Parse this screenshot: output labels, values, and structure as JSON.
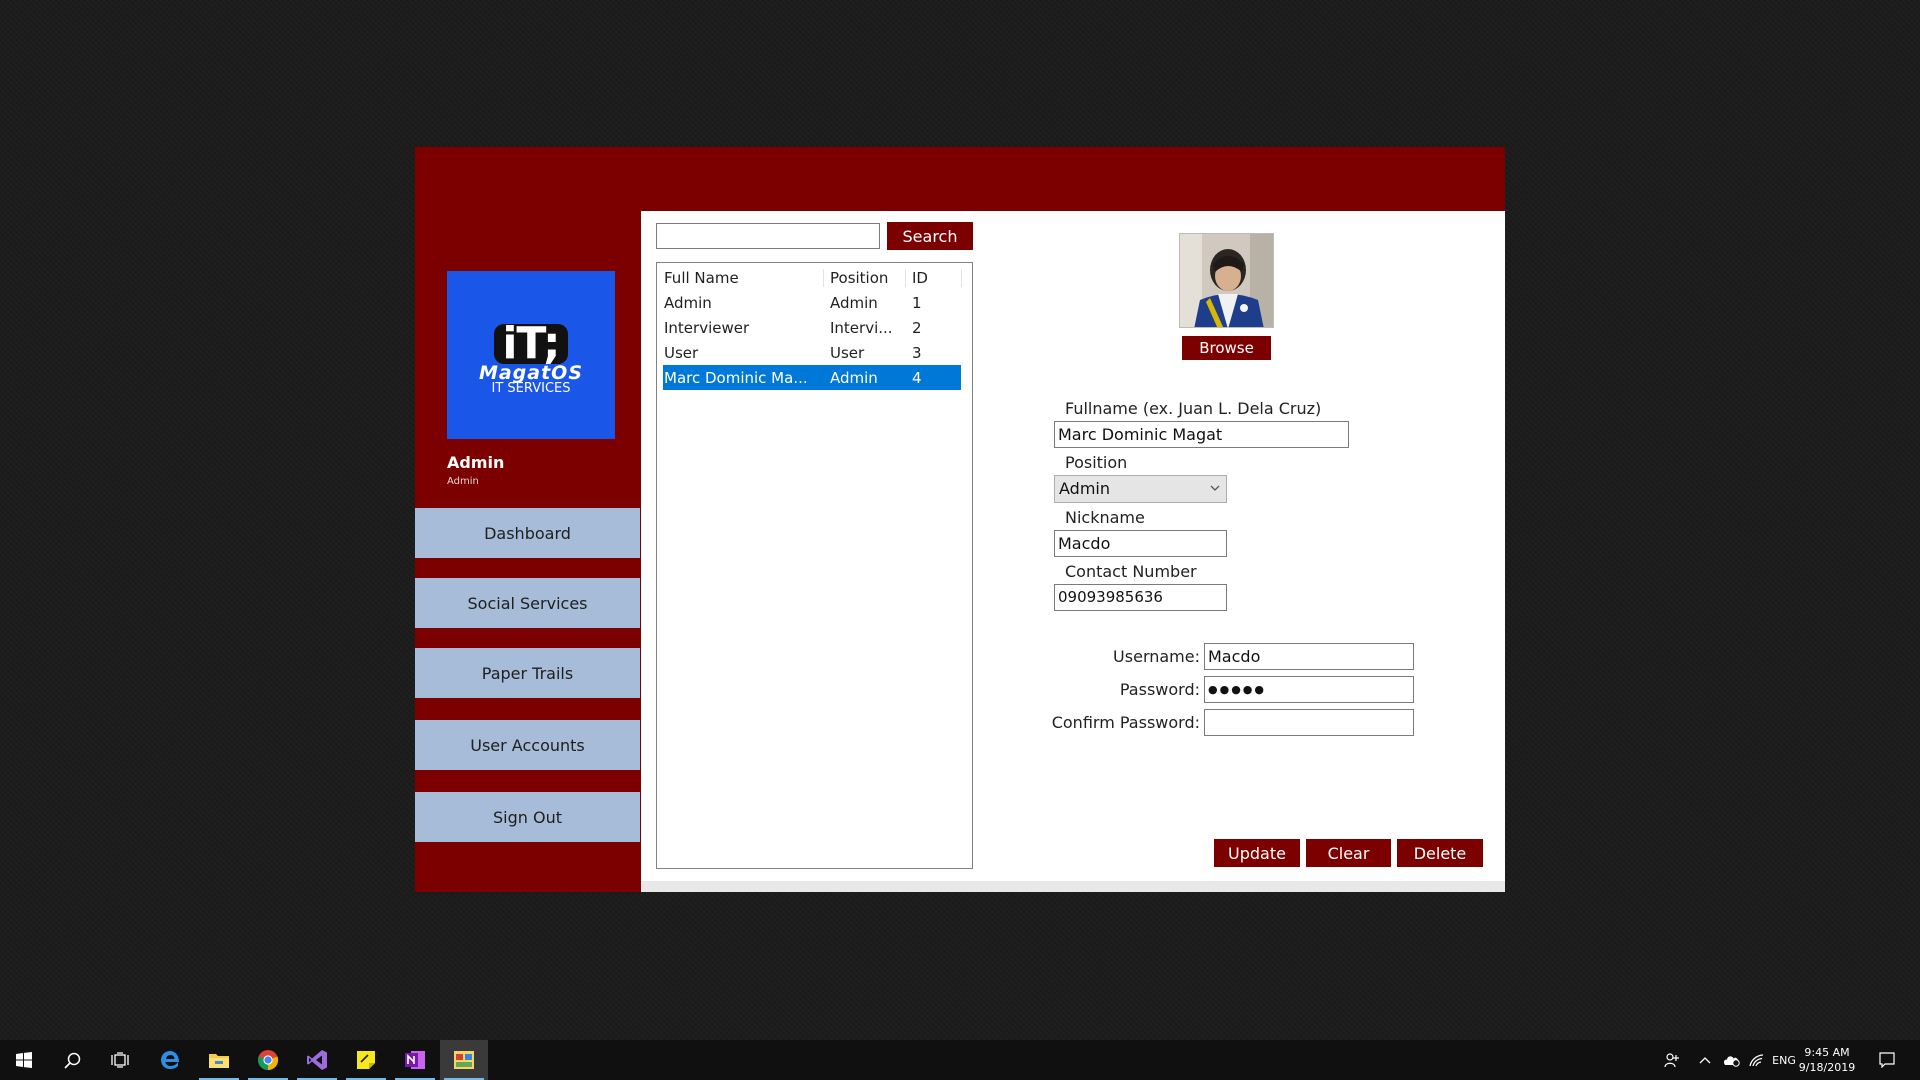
{
  "sidebar": {
    "logo": {
      "mark": "iT;",
      "name": "MagatOS",
      "sub": "IT SERVICES"
    },
    "user_name": "Admin",
    "user_role": "Admin",
    "nav": [
      {
        "label": "Dashboard"
      },
      {
        "label": "Social Services"
      },
      {
        "label": "Paper Trails"
      },
      {
        "label": "User Accounts"
      },
      {
        "label": "Sign Out"
      }
    ]
  },
  "search": {
    "value": "",
    "button_label": "Search"
  },
  "accounts_list": {
    "headers": [
      "Full Name",
      "Position",
      "ID"
    ],
    "rows": [
      {
        "name": "Admin",
        "position": "Admin",
        "id": "1"
      },
      {
        "name": "Interviewer",
        "position": "Intervi...",
        "id": "2"
      },
      {
        "name": "User",
        "position": "User",
        "id": "3"
      },
      {
        "name": "Marc Dominic Ma...",
        "position": "Admin",
        "id": "4"
      }
    ],
    "selected_index": 3
  },
  "profile": {
    "browse_label": "Browse",
    "fullname_label": "Fullname (ex. Juan L. Dela Cruz)",
    "fullname_value": "Marc Dominic Magat",
    "position_label": "Position",
    "position_value": "Admin",
    "nickname_label": "Nickname",
    "nickname_value": "Macdo",
    "contact_label": "Contact Number",
    "contact_value": "09093985636",
    "username_label": "Username:",
    "username_value": "Macdo",
    "password_label": "Password:",
    "password_value": "●●●●●",
    "confirm_label": "Confirm Password:",
    "confirm_value": ""
  },
  "actions": {
    "update": "Update",
    "clear": "Clear",
    "delete": "Delete"
  },
  "taskbar": {
    "pinned": [
      "start-icon",
      "search-icon",
      "task-view-icon",
      "edge-icon",
      "file-explorer-icon",
      "chrome-icon",
      "visual-studio-icon",
      "sticky-notes-icon",
      "onenote-icon",
      "app-window-icon"
    ],
    "language": "ENG",
    "time": "9:45 AM",
    "date": "9/18/2019"
  },
  "colors": {
    "brand_red": "#7d0000",
    "nav_blue": "#a6bcd8",
    "logo_blue": "#1a56e8",
    "selection": "#0078d7"
  }
}
